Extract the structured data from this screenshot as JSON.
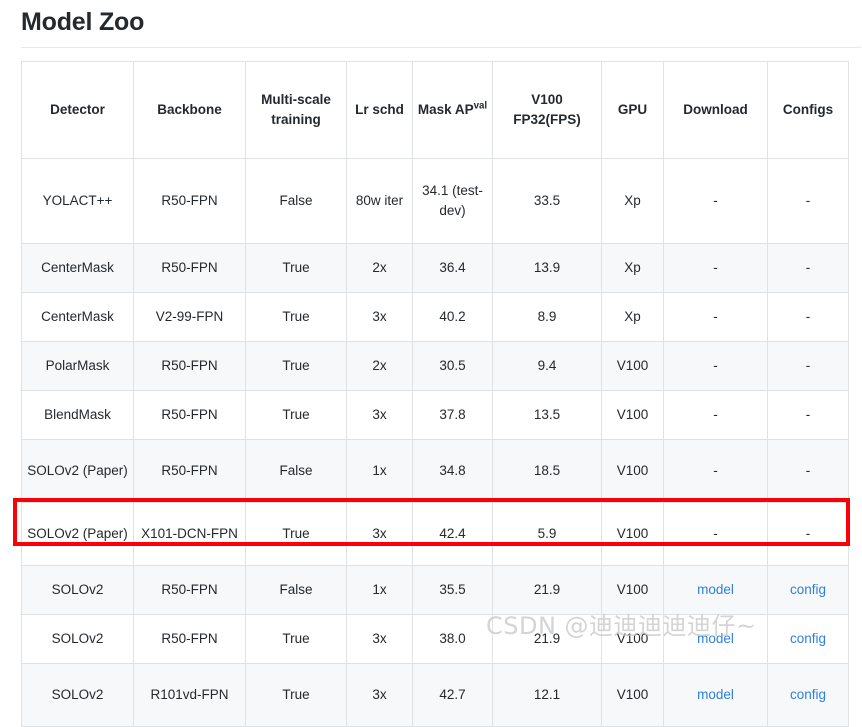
{
  "page": {
    "title": "Model Zoo"
  },
  "watermark": {
    "text": "CSDN @迪迪迪迪迪仔~"
  },
  "colors": {
    "link": "#2f7fe0",
    "highlight_box": "#fb0007",
    "table_border": "#dfe2e5",
    "row_stripe": "#f6f8fa",
    "text": "#24292e"
  },
  "table": {
    "headers": [
      {
        "label": "Detector",
        "sup": ""
      },
      {
        "label": "Backbone",
        "sup": ""
      },
      {
        "label": "Multi-scale training",
        "sup": ""
      },
      {
        "label": "Lr schd",
        "sup": ""
      },
      {
        "label": "Mask AP",
        "sup": "val"
      },
      {
        "label": "V100 FP32(FPS)",
        "sup": ""
      },
      {
        "label": "GPU",
        "sup": ""
      },
      {
        "label": "Download",
        "sup": ""
      },
      {
        "label": "Configs",
        "sup": ""
      }
    ],
    "rows": [
      {
        "detector": "YOLACT++",
        "backbone": "R50-FPN",
        "multiscale": "False",
        "lr_schd": "80w iter",
        "mask_ap": "34.1 (test-dev)",
        "fps": "33.5",
        "gpu": "Xp",
        "download": "-",
        "configs": "-",
        "download_is_link": false,
        "configs_is_link": false,
        "height": "tall",
        "highlighted": false
      },
      {
        "detector": "CenterMask",
        "backbone": "R50-FPN",
        "multiscale": "True",
        "lr_schd": "2x",
        "mask_ap": "36.4",
        "fps": "13.9",
        "gpu": "Xp",
        "download": "-",
        "configs": "-",
        "download_is_link": false,
        "configs_is_link": false,
        "height": "short",
        "highlighted": false
      },
      {
        "detector": "CenterMask",
        "backbone": "V2-99-FPN",
        "multiscale": "True",
        "lr_schd": "3x",
        "mask_ap": "40.2",
        "fps": "8.9",
        "gpu": "Xp",
        "download": "-",
        "configs": "-",
        "download_is_link": false,
        "configs_is_link": false,
        "height": "short",
        "highlighted": false
      },
      {
        "detector": "PolarMask",
        "backbone": "R50-FPN",
        "multiscale": "True",
        "lr_schd": "2x",
        "mask_ap": "30.5",
        "fps": "9.4",
        "gpu": "V100",
        "download": "-",
        "configs": "-",
        "download_is_link": false,
        "configs_is_link": false,
        "height": "short",
        "highlighted": false
      },
      {
        "detector": "BlendMask",
        "backbone": "R50-FPN",
        "multiscale": "True",
        "lr_schd": "3x",
        "mask_ap": "37.8",
        "fps": "13.5",
        "gpu": "V100",
        "download": "-",
        "configs": "-",
        "download_is_link": false,
        "configs_is_link": false,
        "height": "short",
        "highlighted": false
      },
      {
        "detector": "SOLOv2 (Paper)",
        "backbone": "R50-FPN",
        "multiscale": "False",
        "lr_schd": "1x",
        "mask_ap": "34.8",
        "fps": "18.5",
        "gpu": "V100",
        "download": "-",
        "configs": "-",
        "download_is_link": false,
        "configs_is_link": false,
        "height": "med",
        "highlighted": false
      },
      {
        "detector": "SOLOv2 (Paper)",
        "backbone": "X101-DCN-FPN",
        "multiscale": "True",
        "lr_schd": "3x",
        "mask_ap": "42.4",
        "fps": "5.9",
        "gpu": "V100",
        "download": "-",
        "configs": "-",
        "download_is_link": false,
        "configs_is_link": false,
        "height": "med",
        "highlighted": false
      },
      {
        "detector": "SOLOv2",
        "backbone": "R50-FPN",
        "multiscale": "False",
        "lr_schd": "1x",
        "mask_ap": "35.5",
        "fps": "21.9",
        "gpu": "V100",
        "download": "model",
        "configs": "config",
        "download_is_link": true,
        "configs_is_link": true,
        "height": "short",
        "highlighted": true
      },
      {
        "detector": "SOLOv2",
        "backbone": "R50-FPN",
        "multiscale": "True",
        "lr_schd": "3x",
        "mask_ap": "38.0",
        "fps": "21.9",
        "gpu": "V100",
        "download": "model",
        "configs": "config",
        "download_is_link": true,
        "configs_is_link": true,
        "height": "short",
        "highlighted": false
      },
      {
        "detector": "SOLOv2",
        "backbone": "R101vd-FPN",
        "multiscale": "True",
        "lr_schd": "3x",
        "mask_ap": "42.7",
        "fps": "12.1",
        "gpu": "V100",
        "download": "model",
        "configs": "config",
        "download_is_link": true,
        "configs_is_link": true,
        "height": "med",
        "highlighted": false
      }
    ]
  }
}
